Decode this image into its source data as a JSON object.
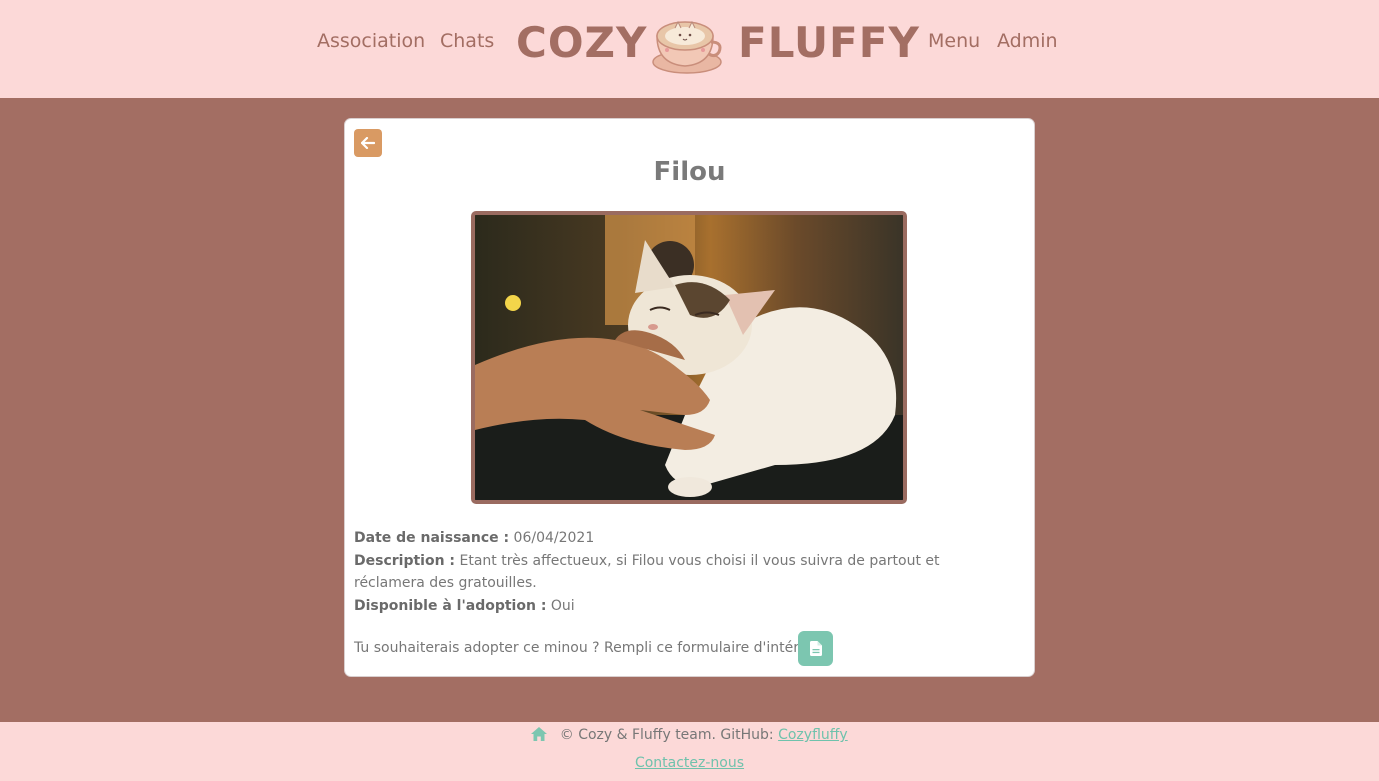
{
  "header": {
    "nav_left": [
      "Association",
      "Chats"
    ],
    "brand_left": "COZY",
    "brand_right": "FLUFFY",
    "nav_right": [
      "Menu",
      "Admin"
    ],
    "logo_icon": "coffee-cup-cat-logo"
  },
  "colors": {
    "header_bg": "#fcd9d8",
    "main_bg": "#a36e63",
    "brand_text": "#a36e63",
    "back_button": "#d99a63",
    "accent_teal": "#7cc6b0"
  },
  "cat": {
    "name": "Filou",
    "photo_alt": "cat-being-petted-photo",
    "birth_label": "Date de naissance :",
    "birth_value": "06/04/2021",
    "description_label": "Description :",
    "description_value": "Etant très affectueux, si Filou vous choisi il vous suivra de partout et réclamera des gratouilles.",
    "adoption_label": "Disponible à l'adoption :",
    "adoption_value": "Oui",
    "form_prompt": "Tu souhaiterais adopter ce minou ? Rempli ce formulaire d'intérêt :"
  },
  "icons": {
    "back": "arrow-left-icon",
    "form": "document-icon",
    "home": "home-icon"
  },
  "footer": {
    "copyright": "© Cozy & Fluffy team. GitHub:",
    "github_link": "Cozyfluffy",
    "contact_link": "Contactez-nous"
  }
}
